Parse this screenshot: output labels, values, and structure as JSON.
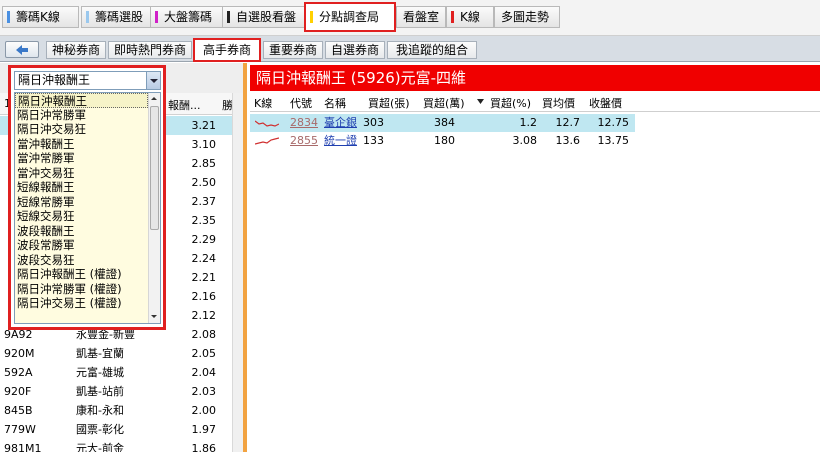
{
  "top_tabs": [
    {
      "label": "籌碼K線",
      "bar_color": "#4a90e2"
    },
    {
      "label": "籌碼選股",
      "bar_color": "#9ac8ee"
    },
    {
      "label": "大盤籌碼",
      "bar_color": "#d020c8"
    },
    {
      "label": "自選股看盤",
      "bar_color": "#222222"
    },
    {
      "label": "分點調查局",
      "bar_color": "#ffd000",
      "active": true
    },
    {
      "label": "看盤室",
      "bar_color": ""
    },
    {
      "label": "K線",
      "bar_color": "#e02020"
    },
    {
      "label": "多圖走勢",
      "bar_color": ""
    }
  ],
  "sub_tabs": [
    "神秘券商",
    "即時熱門券商",
    "高手券商",
    "重要券商",
    "自選券商",
    "我追蹤的組合"
  ],
  "active_sub_tab": "高手券商",
  "dropdown": {
    "selected": "隔日沖報酬王",
    "options": [
      "隔日沖報酬王",
      "隔日沖常勝軍",
      "隔日沖交易狂",
      "當沖報酬王",
      "當沖常勝軍",
      "當沖交易狂",
      "短線報酬王",
      "短線常勝軍",
      "短線交易狂",
      "波段報酬王",
      "波段常勝軍",
      "波段交易狂",
      "隔日沖報酬王 (權證)",
      "隔日沖常勝軍 (權證)",
      "隔日沖交易王 (權證)"
    ]
  },
  "left_table": {
    "col_header_first": "1",
    "col_header_return": "報酬...",
    "col_header_win": "勝率",
    "rows_hidden_values": [
      "3.21",
      "3.10",
      "2.85",
      "2.50",
      "2.37",
      "2.35",
      "2.29",
      "2.24",
      "2.21",
      "2.16",
      "2.12"
    ],
    "rows": [
      {
        "code": "9A92",
        "name": "永豐金-新豐",
        "value": "2.08"
      },
      {
        "code": "920M",
        "name": "凱基-宜蘭",
        "value": "2.05"
      },
      {
        "code": "592A",
        "name": "元富-雄城",
        "value": "2.04"
      },
      {
        "code": "920F",
        "name": "凱基-站前",
        "value": "2.03"
      },
      {
        "code": "845B",
        "name": "康和-永和",
        "value": "2.00"
      },
      {
        "code": "779W",
        "name": "國票-彰化",
        "value": "1.97"
      },
      {
        "code": "981M1",
        "name": "元大-前金",
        "value": "1.86"
      }
    ]
  },
  "right_panel": {
    "title": "隔日沖報酬王 (5926)元富-四維",
    "headers": [
      "K線",
      "代號",
      "名稱",
      "買超(張)",
      "買超(萬)",
      "買超(%)",
      "買均價",
      "收盤價"
    ],
    "rows": [
      {
        "code": "2834",
        "name": "臺企銀",
        "lots": "303",
        "amount": "384",
        "pct": "1.2",
        "avg": "12.7",
        "close": "12.75"
      },
      {
        "code": "2855",
        "name": "統一證",
        "lots": "133",
        "amount": "180",
        "pct": "3.08",
        "avg": "13.6",
        "close": "13.75"
      }
    ]
  }
}
